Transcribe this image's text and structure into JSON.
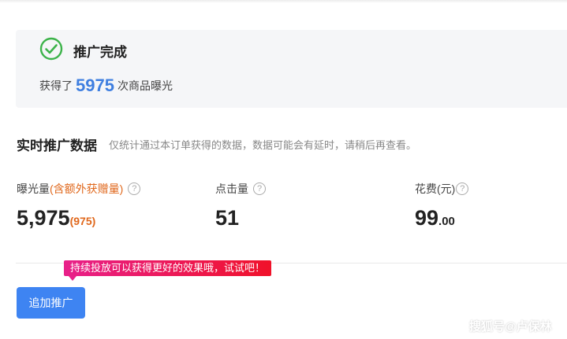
{
  "status": {
    "title": "推广完成",
    "exposure_prefix": "获得了",
    "exposure_count": "5975",
    "exposure_suffix": "次商品曝光",
    "icon": "check-circle-icon"
  },
  "realtime": {
    "title": "实时推广数据",
    "note": "仅统计通过本订单获得的数据，数据可能会有延时，请稍后再查看。"
  },
  "metrics": {
    "exposure": {
      "label": "曝光量",
      "label_sub": "(含额外获赠量)",
      "value": "5,975",
      "extra": "(975)"
    },
    "clicks": {
      "label": "点击量",
      "value": "51"
    },
    "cost": {
      "label": "花费(元)",
      "value_int": "99",
      "value_dec": ".00"
    }
  },
  "help_glyph": "?",
  "tooltip": "持续投放可以获得更好的效果哦，试试吧！",
  "add_button": "追加推广",
  "watermark": "搜狐号@卢保林",
  "colors": {
    "accent": "#3e84f2",
    "success": "#3cb34a",
    "highlight": "#e0671b"
  }
}
